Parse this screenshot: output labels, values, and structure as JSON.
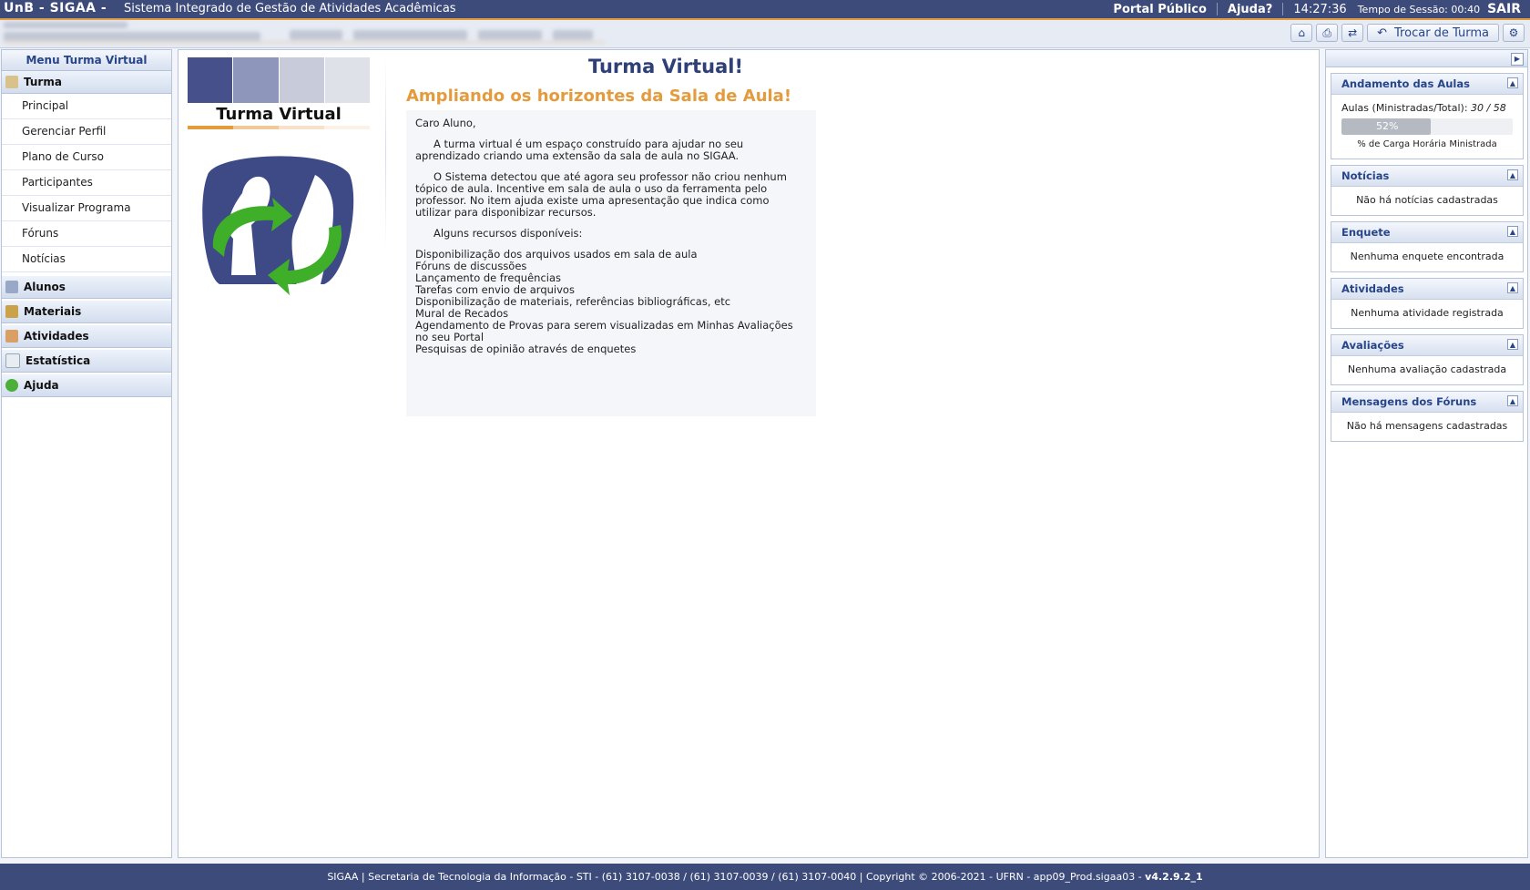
{
  "topbar": {
    "brand": "UnB - SIGAA -",
    "system": "Sistema Integrado de Gestão de Atividades Acadêmicas",
    "portal_publico": "Portal Público",
    "ajuda": "Ajuda?",
    "clock": "14:27:36",
    "session": "Tempo de Sessão: 00:40",
    "logout": "SAIR"
  },
  "toolbar": {
    "home_icon": "home-icon",
    "print_icon": "print-icon",
    "swap_icon": "swap-icon",
    "trocar_turma": "Trocar de Turma",
    "settings_icon": "gear-icon"
  },
  "left_menu": {
    "title": "Menu Turma Virtual",
    "turma": "Turma",
    "items": [
      "Principal",
      "Gerenciar Perfil",
      "Plano de Curso",
      "Participantes",
      "Visualizar Programa",
      "Fóruns",
      "Notícias"
    ],
    "alunos": "Alunos",
    "materiais": "Materiais",
    "atividades": "Atividades",
    "estatistica": "Estatística",
    "ajuda": "Ajuda"
  },
  "main": {
    "logo_text": "Turma Virtual",
    "title": "Turma Virtual!",
    "subtitle": "Ampliando os horizontes da Sala de Aula!",
    "greeting": "Caro Aluno,",
    "p1": "A turma virtual é um espaço construído para ajudar no seu aprendizado criando uma extensão da sala de aula no SIGAA.",
    "p2": "O Sistema detectou que até agora seu professor não criou nenhum tópico de aula. Incentive em sala de aula o uso da ferramenta pelo professor. No item ajuda existe uma apresentação que indica como utilizar para disponibizar recursos.",
    "p3": "Alguns recursos disponíveis:",
    "resources": [
      "Disponibilização dos arquivos usados em sala de aula",
      "Fóruns de discussões",
      "Lançamento de frequências",
      "Tarefas com envio de arquivos",
      "Disponibilização de materiais, referências bibliográficas, etc",
      "Mural de Recados",
      "Agendamento de Provas para serem visualizadas em Minhas Avaliações no seu Portal",
      "Pesquisas de opinião através de enquetes"
    ]
  },
  "right": {
    "andamento": {
      "title": "Andamento das Aulas",
      "label": "Aulas (Ministradas/Total):",
      "value": "30 / 58",
      "percent_text": "52%",
      "percent": 0.52,
      "caption": "% de Carga Horária Ministrada"
    },
    "noticias": {
      "title": "Notícias",
      "text": "Não há notícias cadastradas"
    },
    "enquete": {
      "title": "Enquete",
      "text": "Nenhuma enquete encontrada"
    },
    "atividades": {
      "title": "Atividades",
      "text": "Nenhuma atividade registrada"
    },
    "avaliacoes": {
      "title": "Avaliações",
      "text": "Nenhuma avaliação cadastrada"
    },
    "mensagens": {
      "title": "Mensagens dos Fóruns",
      "text": "Não há mensagens cadastradas"
    }
  },
  "footer": {
    "text": "SIGAA | Secretaria de Tecnologia da Informação - STI - (61) 3107-0038 / (61) 3107-0039 / (61) 3107-0040 | Copyright © 2006-2021 - UFRN - app09_Prod.sigaa03 -",
    "version": "v4.2.9.2_1"
  },
  "colors": {
    "header_bg": "#3c4b7a",
    "accent_orange": "#e39b3d",
    "title_blue": "#2f3f78",
    "link_blue": "#274589"
  }
}
